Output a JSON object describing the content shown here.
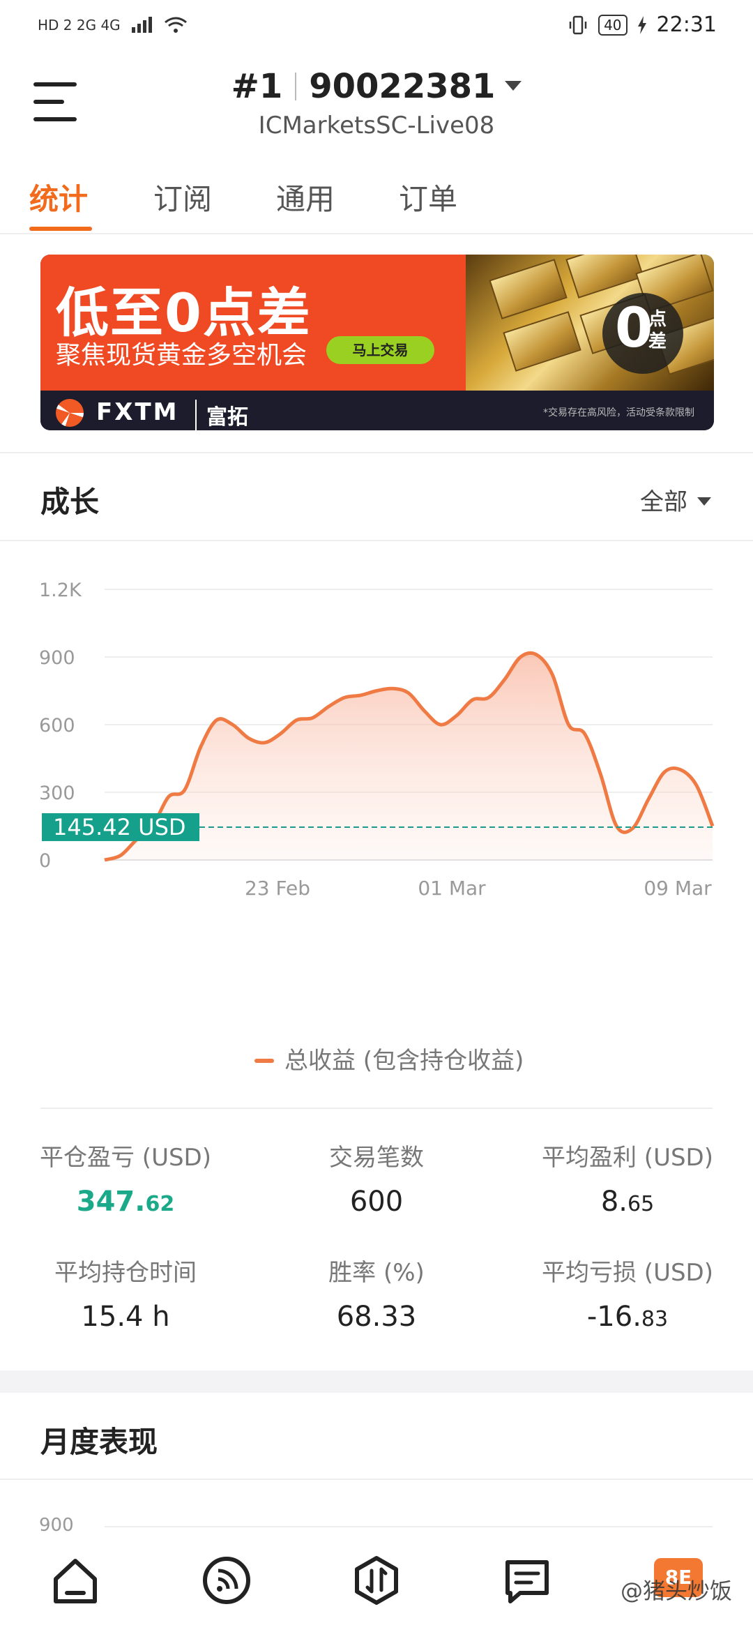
{
  "status_bar": {
    "left": "HD 2  2G  4G",
    "battery": "40",
    "time": "22:31"
  },
  "header": {
    "rank": "#1",
    "account": "90022381",
    "server": "ICMarketsSC-Live08"
  },
  "tabs": [
    {
      "label": "统计",
      "active": true
    },
    {
      "label": "订阅",
      "active": false
    },
    {
      "label": "通用",
      "active": false
    },
    {
      "label": "订单",
      "active": false
    }
  ],
  "banner": {
    "headline": "低至0点差",
    "subline": "聚焦现货黄金多空机会",
    "button": "马上交易",
    "zero": "0",
    "zero_caption": "点差",
    "brand": "FXTM",
    "brand_cn": "富拓",
    "disclaimer": "*交易存在高风险，活动受条款限制"
  },
  "growth": {
    "title": "成长",
    "filter": "全部"
  },
  "chart_data": {
    "type": "area",
    "title": "",
    "xlabel": "",
    "ylabel": "",
    "ylim": [
      0,
      1200
    ],
    "y_ticks": [
      "0",
      "300",
      "600",
      "900",
      "1.2K"
    ],
    "x_ticks": [
      "23 Feb",
      "01 Mar",
      "09 Mar"
    ],
    "series": [
      {
        "name": "总收益 (包含持仓收益)",
        "color": "#f07a44",
        "values": [
          0,
          20,
          90,
          150,
          280,
          310,
          500,
          620,
          600,
          540,
          520,
          560,
          620,
          630,
          680,
          720,
          730,
          750,
          760,
          740,
          660,
          600,
          640,
          710,
          720,
          800,
          900,
          910,
          820,
          600,
          560,
          380,
          150,
          140,
          270,
          390,
          400,
          330,
          150
        ]
      }
    ],
    "current_value_label": "145.42 USD",
    "current_value": 145.42,
    "legend": "总收益 (包含持仓收益)",
    "legend_position": "bottom"
  },
  "stats": [
    {
      "label": "平仓盈亏 (USD)",
      "int": "347.",
      "dec": "62",
      "style": "green"
    },
    {
      "label": "交易笔数",
      "int": "600",
      "dec": "",
      "style": "normal"
    },
    {
      "label": "平均盈利 (USD)",
      "int": "8.",
      "dec": "65",
      "style": "normal"
    },
    {
      "label": "平均持仓时间",
      "int": "15.4 h",
      "dec": "",
      "style": "normal"
    },
    {
      "label": "胜率 (%)",
      "int": "68.33",
      "dec": "",
      "style": "normal"
    },
    {
      "label": "平均亏损 (USD)",
      "int": "-16.",
      "dec": "83",
      "style": "normal"
    }
  ],
  "monthly": {
    "title": "月度表现",
    "first_tick": "900"
  },
  "watermark": "@猪头炒饭",
  "colors": {
    "accent": "#f26a1b",
    "green": "#1ba98a",
    "line": "#f07a44"
  }
}
